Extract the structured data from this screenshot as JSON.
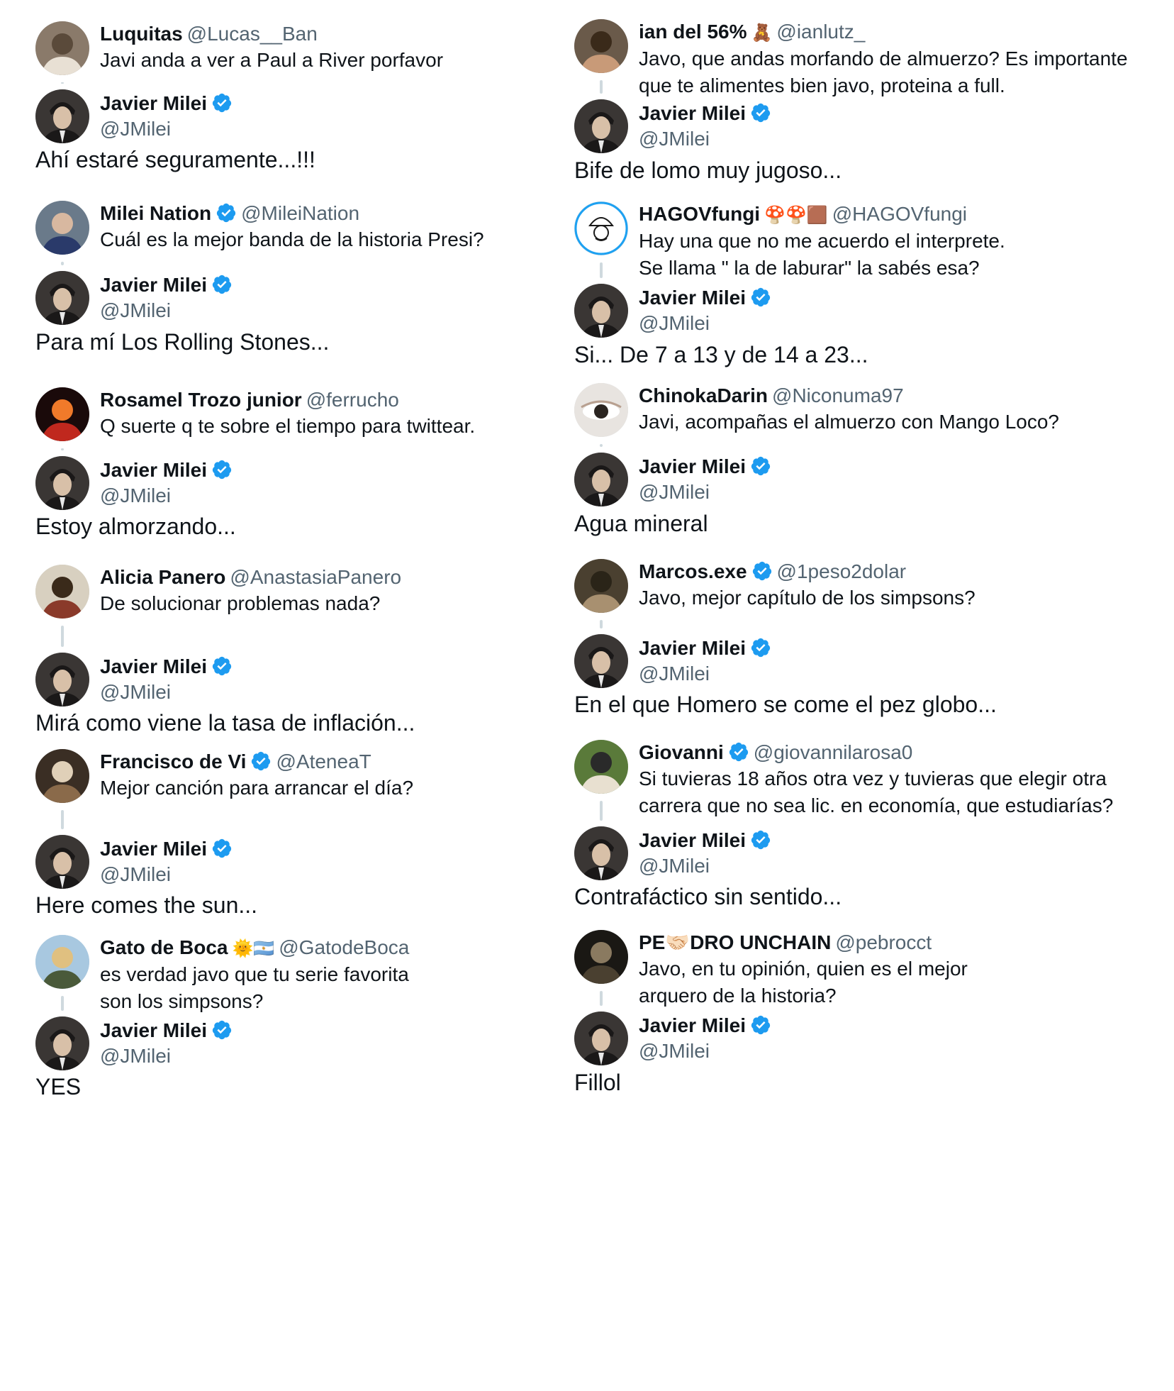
{
  "reply_author": {
    "name": "Javier Milei",
    "handle": "@JMilei"
  },
  "left": [
    {
      "q_name": "Luquitas",
      "q_emoji": "",
      "q_verified": false,
      "q_handle": "@Lucas__Ban",
      "q_text": [
        "Javi anda a ver a Paul a River porfavor"
      ],
      "answer": "Ahí estaré seguramente...!!!",
      "avatar": "cats"
    },
    {
      "q_name": "Milei Nation",
      "q_emoji": "",
      "q_verified": true,
      "q_handle": "@MileiNation",
      "q_text": [
        "Cuál es la mejor banda de la historia Presi?"
      ],
      "answer": "Para mí Los Rolling Stones...",
      "avatar": "person-blue"
    },
    {
      "q_name": "Rosamel Trozo junior",
      "q_emoji": "",
      "q_verified": false,
      "q_handle": "@ferrucho",
      "q_text": [
        "Q suerte q te sobre el tiempo para twittear."
      ],
      "answer": "Estoy almorzando...",
      "avatar": "red-mask"
    },
    {
      "q_name": "Alicia Panero",
      "q_emoji": "",
      "q_verified": false,
      "q_handle": "@AnastasiaPanero",
      "q_text": [
        "De solucionar problemas nada?"
      ],
      "answer": "Mirá como viene la tasa de inflación...",
      "avatar": "book"
    },
    {
      "q_name": "Francisco de Vi",
      "q_emoji": "",
      "q_verified": true,
      "q_handle": "@AteneaT",
      "q_text": [
        "Mejor canción para arrancar el día?"
      ],
      "answer": "Here comes the sun...",
      "avatar": "painting"
    },
    {
      "q_name": "Gato de Boca",
      "q_emoji": "🌞🇦🇷",
      "q_verified": false,
      "q_handle": "@GatodeBoca",
      "q_text": [
        "es verdad javo que tu serie favorita",
        "son los simpsons?"
      ],
      "answer": "YES",
      "avatar": "cat-boots"
    }
  ],
  "right": [
    {
      "q_name": "ian del 56%",
      "q_emoji": "🧸",
      "q_verified": false,
      "q_handle": "@ianlutz_",
      "q_text": [
        "Javo, que andas morfando de almuerzo? Es importante",
        "que te alimentes bien javo, proteina a full."
      ],
      "answer": "Bife de lomo muy jugoso...",
      "avatar": "torso"
    },
    {
      "q_name": "HAGOVfungi",
      "q_emoji": "🍄🍄🟫",
      "q_verified": false,
      "q_handle": "@HAGOVfungi",
      "q_text": [
        "Hay una que no me acuerdo el interprete.",
        "Se llama \" la de laburar\" la sabés esa?"
      ],
      "answer": "Si... De 7 a 13 y de 14 a 23...",
      "avatar": "logo"
    },
    {
      "q_name": "ChinokaDarin",
      "q_emoji": "",
      "q_verified": false,
      "q_handle": "@Niconuma97",
      "q_text": [
        "Javi, acompañas el almuerzo con Mango Loco?"
      ],
      "answer": "Agua mineral",
      "avatar": "eye"
    },
    {
      "q_name": "Marcos.exe",
      "q_emoji": "",
      "q_verified": true,
      "q_handle": "@1peso2dolar",
      "q_text": [
        "Javo, mejor capítulo de los simpsons?"
      ],
      "answer": "En el que Homero se come el pez globo...",
      "avatar": "street"
    },
    {
      "q_name": "Giovanni",
      "q_emoji": "",
      "q_verified": true,
      "q_handle": "@giovannilarosa0",
      "q_text": [
        "Si tuvieras 18 años otra vez y tuvieras que elegir otra",
        "carrera que no sea lic. en economía, que estudiarías?"
      ],
      "answer": "Contrafáctico sin sentido...",
      "avatar": "person-green"
    },
    {
      "q_name": "PE🤝🏻DRO UNCHAIN",
      "q_emoji": "",
      "q_verified": false,
      "q_handle": "@pebrocct",
      "q_text": [
        "Javo, en tu opinión, quien es el mejor",
        "arquero de la historia?"
      ],
      "answer": "Fillol",
      "avatar": "dark"
    }
  ]
}
